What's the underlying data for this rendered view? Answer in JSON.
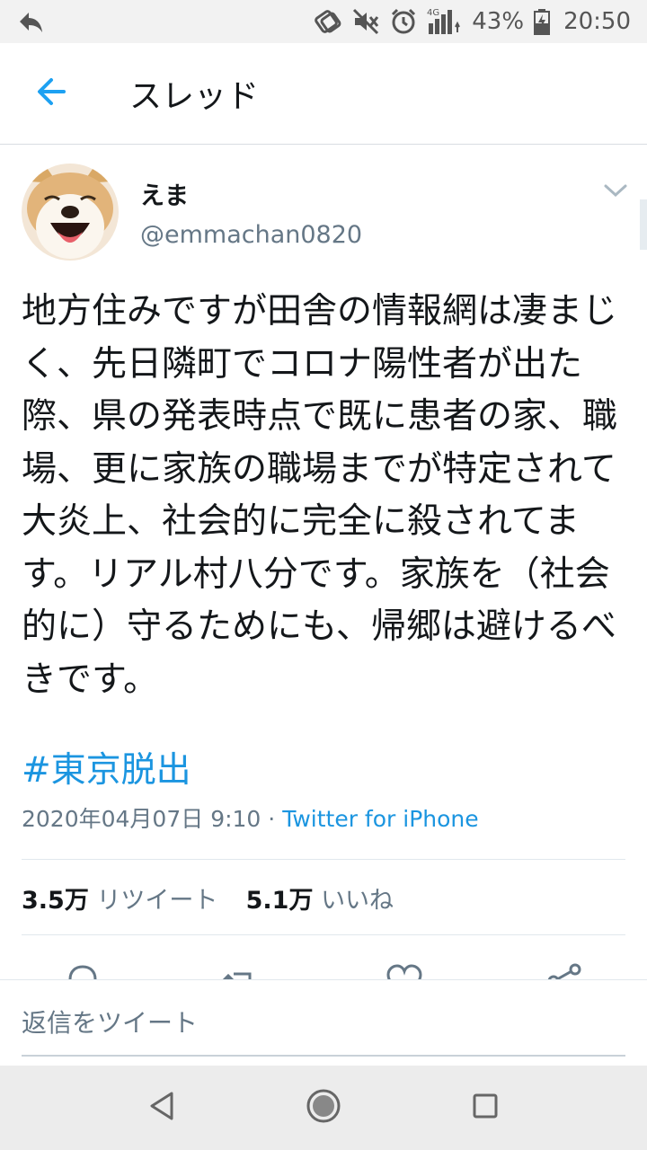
{
  "status_bar": {
    "network": "4G",
    "battery": "43%",
    "time": "20:50",
    "icons": [
      "back-arrow-icon",
      "nfc-icon",
      "mute-icon",
      "alarm-icon",
      "signal-icon",
      "battery-icon"
    ]
  },
  "header": {
    "title": "スレッド",
    "back_icon": "arrow-left-icon"
  },
  "tweet": {
    "author_name": "えま",
    "handle": "@emmachan0820",
    "text": "地方住みですが田舎の情報網は凄まじく、先日隣町でコロナ陽性者が出た際、県の発表時点で既に患者の家、職場、更に家族の職場までが特定されて大炎上、社会的に完全に殺されてます。リアル村八分です。家族を（社会的に）守るためにも、帰郷は避けるべきです。",
    "hashtag": "#東京脱出",
    "date": "2020年04月07日 9:10",
    "separator": " · ",
    "source": "Twitter for iPhone",
    "retweet_count": "3.5万",
    "retweet_label": "リツイート",
    "like_count": "5.1万",
    "like_label": "いいね"
  },
  "reply": {
    "placeholder": "返信をツイート"
  },
  "colors": {
    "link": "#1b95e0",
    "secondary": "#657786",
    "accent": "#1da1f2"
  }
}
